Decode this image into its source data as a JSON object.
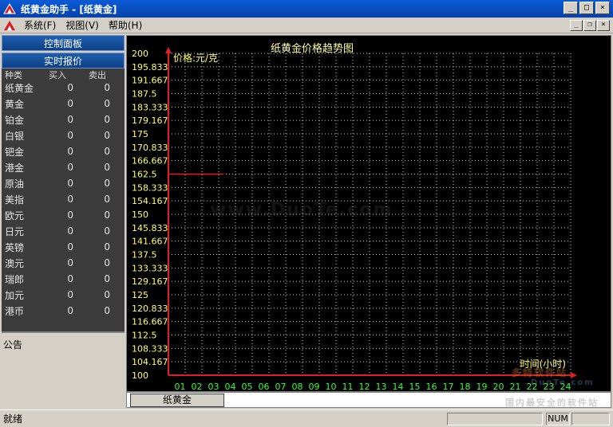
{
  "window": {
    "title": "纸黄金助手 - [纸黄金]"
  },
  "menu": [
    {
      "label": "系统(F)"
    },
    {
      "label": "视图(V)"
    },
    {
      "label": "帮助(H)"
    }
  ],
  "sidebar": {
    "panel_label": "控制面板",
    "quotes_label": "实时报价",
    "columns": {
      "name": "种类",
      "buy": "买入",
      "sell": "卖出"
    },
    "rows": [
      {
        "name": "纸黄金",
        "buy": "0",
        "sell": "0"
      },
      {
        "name": "黄金",
        "buy": "0",
        "sell": "0"
      },
      {
        "name": "铂金",
        "buy": "0",
        "sell": "0"
      },
      {
        "name": "白银",
        "buy": "0",
        "sell": "0"
      },
      {
        "name": "钯金",
        "buy": "0",
        "sell": "0"
      },
      {
        "name": "港金",
        "buy": "0",
        "sell": "0"
      },
      {
        "name": "原油",
        "buy": "0",
        "sell": "0"
      },
      {
        "name": "美指",
        "buy": "0",
        "sell": "0"
      },
      {
        "name": "欧元",
        "buy": "0",
        "sell": "0"
      },
      {
        "name": "日元",
        "buy": "0",
        "sell": "0"
      },
      {
        "name": "英镑",
        "buy": "0",
        "sell": "0"
      },
      {
        "name": "澳元",
        "buy": "0",
        "sell": "0"
      },
      {
        "name": "瑞郎",
        "buy": "0",
        "sell": "0"
      },
      {
        "name": "加元",
        "buy": "0",
        "sell": "0"
      },
      {
        "name": "港币",
        "buy": "0",
        "sell": "0"
      }
    ],
    "notice_label": "公告"
  },
  "chart_data": {
    "type": "line",
    "title": "纸黄金价格趋势图",
    "ylabel": "价格:元/克",
    "xlabel": "时间(小时)",
    "ylim": [
      100,
      200
    ],
    "y_ticks": [
      "200",
      "195.833",
      "191.667",
      "187.5",
      "183.333",
      "179.167",
      "175",
      "170.833",
      "166.667",
      "162.5",
      "158.333",
      "154.167",
      "150",
      "145.833",
      "141.667",
      "137.5",
      "133.333",
      "129.167",
      "125",
      "120.833",
      "116.667",
      "112.5",
      "108.333",
      "104.167",
      "100"
    ],
    "x_ticks": [
      "01",
      "02",
      "03",
      "04",
      "05",
      "06",
      "07",
      "08",
      "09",
      "10",
      "11",
      "12",
      "13",
      "14",
      "15",
      "16",
      "17",
      "18",
      "19",
      "20",
      "21",
      "22",
      "23",
      "24"
    ],
    "grid": true,
    "series": [
      {
        "x": [
          0,
          3.3
        ],
        "y": [
          162.5,
          162.5
        ],
        "color": "#e02020"
      }
    ],
    "colors": {
      "axis": "#e02020",
      "grid": "#c8c8c8",
      "y_tick": "#ffff66",
      "x_tick": "#33ff33",
      "title": "#ffff99",
      "ylabel": "#ffff66",
      "xlabel": "#ffff66"
    }
  },
  "tabs": [
    {
      "label": "纸黄金"
    }
  ],
  "status": {
    "text": "就绪",
    "num": "NUM"
  },
  "watermarks": [
    "www.DuoTe.com",
    "多特软件站",
    "DuoTe.com",
    "国内最安全的软件站"
  ]
}
